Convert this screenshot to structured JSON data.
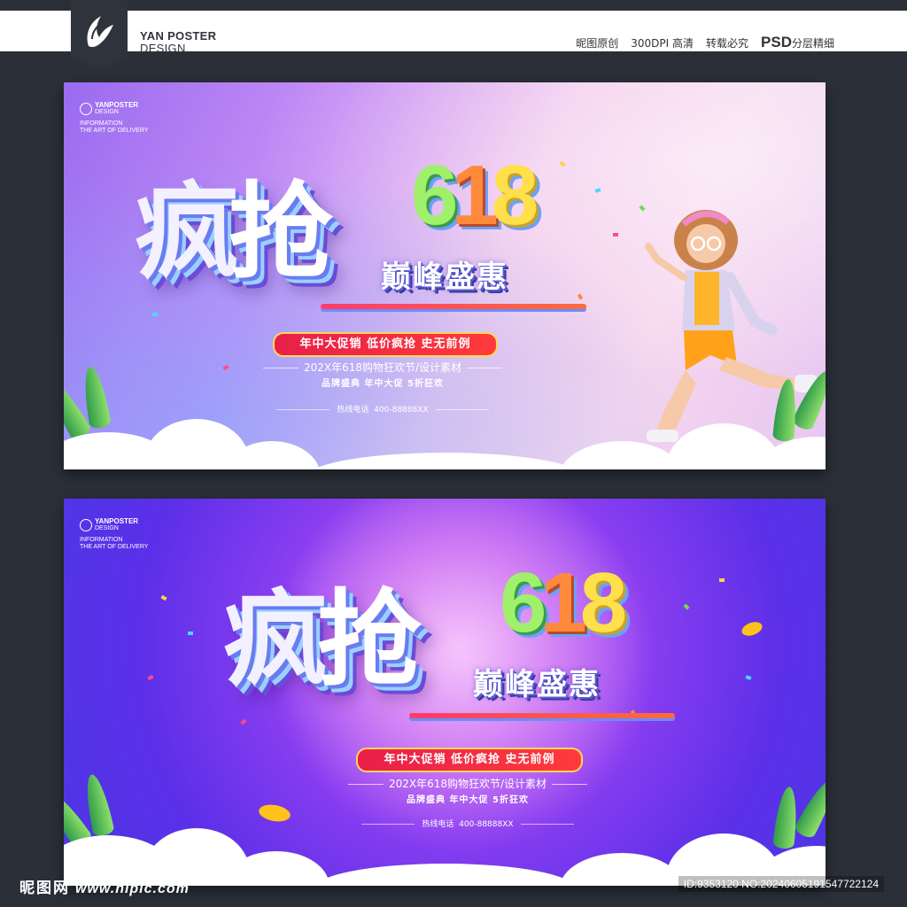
{
  "header": {
    "brand_line1": "YAN POSTER",
    "brand_line2": "DESIGN",
    "tags": [
      "昵图原创",
      "300DPI 高清",
      "转载必究"
    ],
    "psd_label": "PSD",
    "psd_suffix": "分层精细",
    "logo_icon": "wing-logo-icon"
  },
  "posters": [
    {
      "variant": "pink",
      "mini_logo_title": "YANPOSTER",
      "mini_logo_sub": "DESIGN",
      "mini_logo_info_1": "INFORMATION",
      "mini_logo_info_2": "THE ART OF DELIVERY",
      "title_chars": [
        "疯",
        "抢"
      ],
      "number_chars": [
        "6",
        "1",
        "8"
      ],
      "subtitle": "巅峰盛惠",
      "pill_text": "年中大促销 低价疯抢 史无前例",
      "line2": "202X年618购物狂欢节/设计素材",
      "line3": "品牌盛典  年中大促  5折狂欢",
      "hotline_label": "热线电话",
      "hotline_number": "400-88888XX"
    },
    {
      "variant": "purple",
      "mini_logo_title": "YANPOSTER",
      "mini_logo_sub": "DESIGN",
      "mini_logo_info_1": "INFORMATION",
      "mini_logo_info_2": "THE ART OF DELIVERY",
      "title_chars": [
        "疯",
        "抢"
      ],
      "number_chars": [
        "6",
        "1",
        "8"
      ],
      "subtitle": "巅峰盛惠",
      "pill_text": "年中大促销 低价疯抢 史无前例",
      "line2": "202X年618购物狂欢节/设计素材",
      "line3": "品牌盛典  年中大促  5折狂欢",
      "hotline_label": "热线电话",
      "hotline_number": "400-88888XX"
    }
  ],
  "footer": {
    "site_name": "昵图网",
    "site_url": "www.nipic.com",
    "id_text": "ID:9353120 NO:20240605191547722124"
  },
  "colors": {
    "background": "#2b2f38",
    "accent_red": "#e81f4a",
    "accent_gold": "#ffd75a"
  }
}
